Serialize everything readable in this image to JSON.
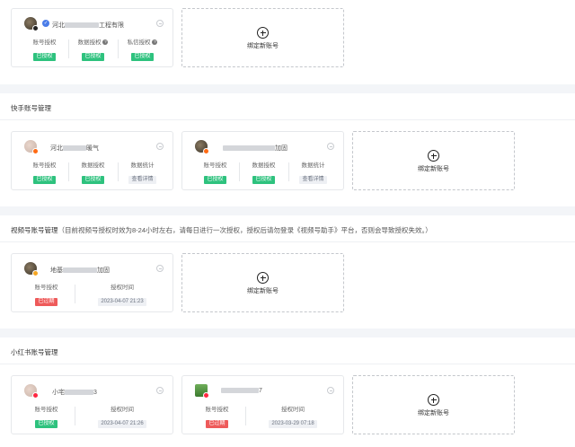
{
  "bind_new_account_label": "绑定新账号",
  "sections": {
    "douyin": {
      "cards": [
        {
          "name_prefix": "河北",
          "name_suffix": "工程有限",
          "stats": [
            {
              "label": "账号授权",
              "value": "已授权",
              "status": "green"
            },
            {
              "label": "数据授权",
              "value": "已授权",
              "status": "green",
              "help_icon": true
            },
            {
              "label": "私信授权",
              "value": "已授权",
              "status": "green",
              "help_icon": true
            }
          ]
        }
      ]
    },
    "kuaishou": {
      "title": "快手账号管理",
      "cards": [
        {
          "name_prefix": "河北",
          "name_suffix": "暖气",
          "stats": [
            {
              "label": "账号授权",
              "value": "已授权",
              "status": "green"
            },
            {
              "label": "数据授权",
              "value": "已授权",
              "status": "green"
            },
            {
              "label": "数据统计",
              "value": "查看详情",
              "status": "grey"
            }
          ]
        },
        {
          "name_prefix": "",
          "name_suffix": "加固",
          "stats": [
            {
              "label": "账号授权",
              "value": "已授权",
              "status": "green"
            },
            {
              "label": "数据授权",
              "value": "已授权",
              "status": "green"
            },
            {
              "label": "数据统计",
              "value": "查看详情",
              "status": "grey"
            }
          ]
        }
      ]
    },
    "video": {
      "title": "视频号账号管理",
      "note": "（目前视频号授权时效为8-24小时左右，请每日进行一次授权，授权后请勿登录《视频号助手》平台，否则会导致授权失效。）",
      "cards": [
        {
          "name_prefix": "地基",
          "name_suffix": "加固",
          "stats": [
            {
              "label": "账号授权",
              "value": "已过期",
              "status": "red"
            },
            {
              "label": "授权时间",
              "value": "2023-04-07 21:23",
              "status": "grey"
            }
          ]
        }
      ]
    },
    "xhs": {
      "title": "小红书账号管理",
      "cards": [
        {
          "name_prefix": "小宅",
          "name_suffix": "3",
          "stats": [
            {
              "label": "账号授权",
              "value": "已授权",
              "status": "green"
            },
            {
              "label": "授权时间",
              "value": "2023-04-07 21:26",
              "status": "grey"
            }
          ]
        },
        {
          "name_prefix": "",
          "name_suffix": "7",
          "stats": [
            {
              "label": "账号授权",
              "value": "已过期",
              "status": "red"
            },
            {
              "label": "授权时间",
              "value": "2023-03-29 07:18",
              "status": "grey"
            }
          ]
        }
      ]
    }
  },
  "colors": {
    "authorized": "#2ec27e",
    "expired": "#ee5a5a",
    "douyin_badge": "#222222",
    "kuaishou_badge": "#ff6a13",
    "video_badge": "#f5a623",
    "xhs_badge": "#ff2741"
  }
}
